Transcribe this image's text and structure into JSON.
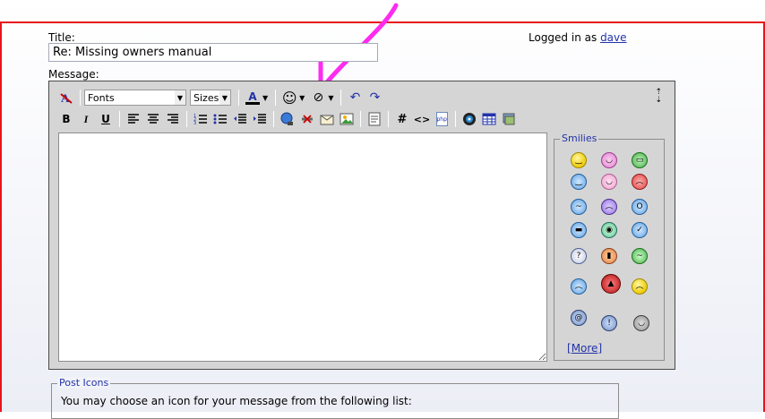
{
  "form": {
    "title_label": "Title:",
    "title_value": "Re: Missing owners manual",
    "logged_prefix": "Logged in as",
    "username": "dave",
    "message_label": "Message:"
  },
  "toolbar": {
    "fonts_label": "Fonts",
    "sizes_label": "Sizes",
    "font_color_glyph": "A",
    "hash_glyph": "#",
    "code_glyph": "<>",
    "php_glyph": "php",
    "bold": "B",
    "italic": "I",
    "underline": "U"
  },
  "smilies": {
    "legend": "Smilies",
    "more_label": "More",
    "icons": [
      "smile",
      "grin-pink",
      "big-grin",
      "happy",
      "laugh-pink",
      "angry",
      "confused",
      "purple-frown",
      "shocked",
      "cool",
      "alien",
      "thumbs-up",
      "question",
      "wall",
      "sick",
      "blue-sad",
      "devil",
      "worried",
      "dizzy",
      "idea",
      "eek",
      "crying"
    ]
  },
  "post_icons": {
    "legend": "Post Icons",
    "description": "You may choose an icon for your message from the following list:"
  },
  "colors": {
    "frame_border": "#e8151b",
    "arrow": "#ff2bf0",
    "link": "#2233aa"
  }
}
